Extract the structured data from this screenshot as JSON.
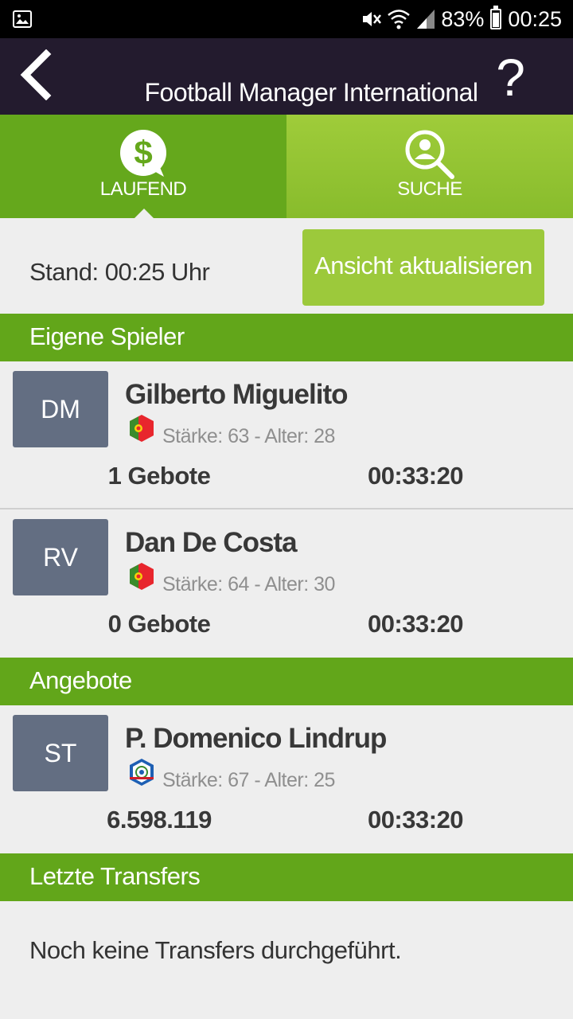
{
  "status_bar": {
    "battery": "83%",
    "time": "00:25",
    "battery_level": 0.83
  },
  "appbar": {
    "title": "Football Manager International",
    "help_label": "?"
  },
  "tabs": [
    {
      "label": "LAUFEND",
      "icon": "dollar-chat-icon",
      "active": true
    },
    {
      "label": "SUCHE",
      "icon": "user-search-icon",
      "active": false
    }
  ],
  "stand": {
    "text": "Stand: 00:25 Uhr",
    "refresh_label": "Ansicht aktualisieren"
  },
  "sections": {
    "own_players": "Eigene Spieler",
    "offers": "Angebote",
    "last_transfers": "Letzte Transfers"
  },
  "own_players": [
    {
      "position": "DM",
      "name": "Gilberto Miguelito",
      "flag": "portugal-flag-icon",
      "stats": "Stärke: 63 - Alter: 28",
      "bids": "1 Gebote",
      "time": "00:33:20"
    },
    {
      "position": "RV",
      "name": "Dan De Costa",
      "flag": "portugal-flag-icon",
      "stats": "Stärke: 64 - Alter: 30",
      "bids": "0 Gebote",
      "time": "00:33:20"
    }
  ],
  "offers": [
    {
      "position": "ST",
      "name": "P. Domenico Lindrup",
      "flag": "belize-flag-icon",
      "stats": "Stärke: 67 - Alter: 25",
      "amount": "6.598.119",
      "time": "00:33:20"
    }
  ],
  "last_transfers": {
    "empty_text": "Noch keine Transfers durchgeführt."
  },
  "colors": {
    "appbar": "#231b2e",
    "tab_active": "#65a81c",
    "tab_inactive": "#9fcc3a",
    "section_header": "#62a61a",
    "refresh_button": "#9cc93b",
    "position_badge": "#636e82"
  }
}
